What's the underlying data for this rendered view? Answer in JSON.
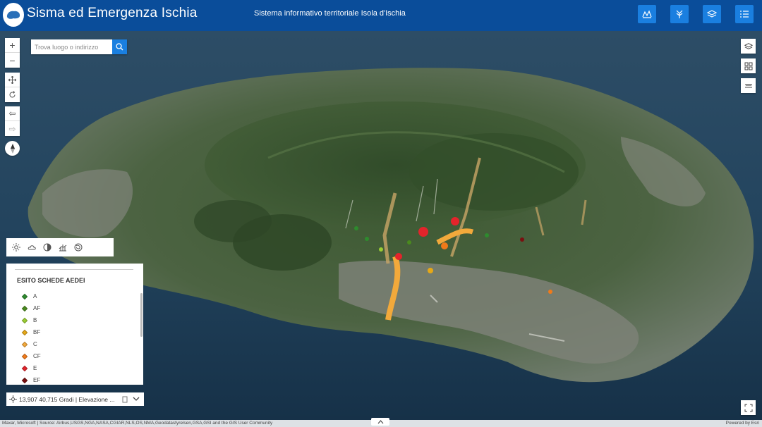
{
  "header": {
    "title": "Sisma ed Emergenza Ischia",
    "subtitle": "Sistema informativo territoriale Isola d'Ischia",
    "buttons": [
      "chart-icon",
      "analysis-icon",
      "layers-icon",
      "list-icon"
    ]
  },
  "search": {
    "placeholder": "Trova luogo o indirizzo"
  },
  "tools": [
    "daylight-icon",
    "weather-icon",
    "shadow-icon",
    "elevation-profile-icon",
    "slice-icon"
  ],
  "legend": {
    "title": "ESITO SCHEDE AEDEI",
    "items": [
      {
        "label": "A",
        "color": "#2e8b2e"
      },
      {
        "label": "AF",
        "color": "#4a8a1e"
      },
      {
        "label": "B",
        "color": "#9acd32"
      },
      {
        "label": "BF",
        "color": "#e6a817"
      },
      {
        "label": "C",
        "color": "#f2a93b"
      },
      {
        "label": "CF",
        "color": "#f07a1a"
      },
      {
        "label": "E",
        "color": "#e3242b"
      },
      {
        "label": "EF",
        "color": "#7a1010"
      }
    ]
  },
  "coordinates": {
    "text": "13,907 40,715 Gradi | Elevazione ..."
  },
  "attribution": {
    "text": "Maxar, Microsoft | Source: Airbus,USGS,NGA,NASA,CGIAR,NLS,OS,NMA,Geodatastyrelsen,GSA,GSI and the GIS User Community",
    "powered": "Powered by Esri"
  },
  "colors": {
    "header": "#0a4d9a",
    "accent": "#1a7fe0"
  }
}
